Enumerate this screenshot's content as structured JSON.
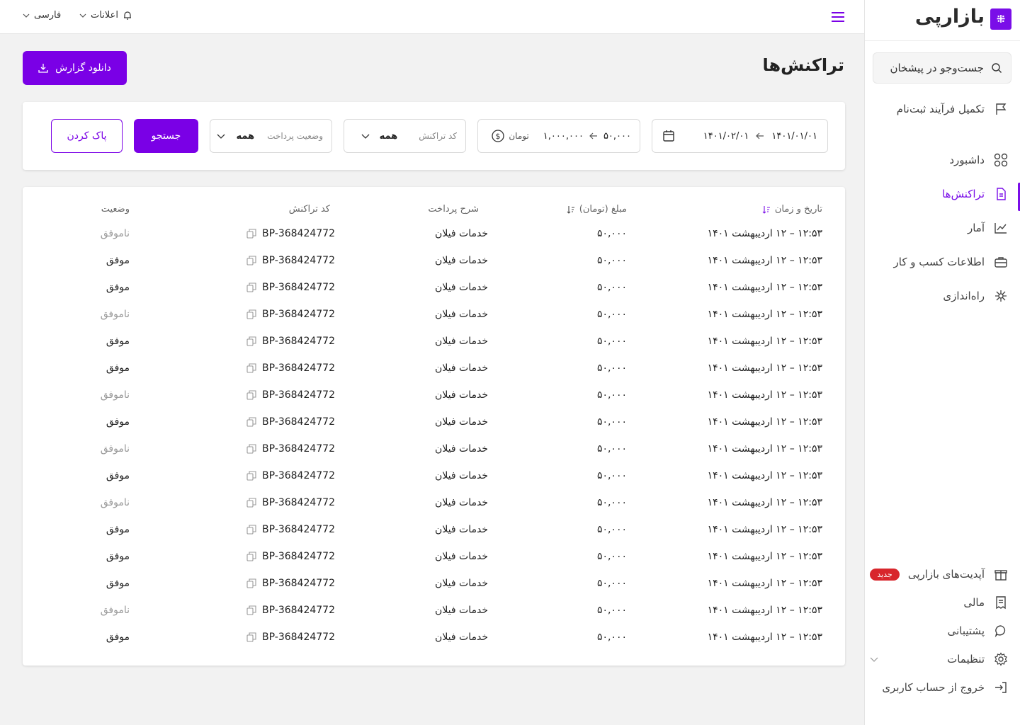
{
  "brand": {
    "name": "بازارپی"
  },
  "topbar": {
    "language": "فارسی",
    "notifications": "اعلانات"
  },
  "sidebar": {
    "search_placeholder": "جست‌وجو در پیشخان",
    "items": [
      {
        "label": "تکمیل فرآیند ثبت‌نام",
        "icon": "flag-icon"
      },
      {
        "label": "داشبورد",
        "icon": "grid-icon"
      },
      {
        "label": "تراکنش‌ها",
        "icon": "document-icon",
        "active": true
      },
      {
        "label": "آمار",
        "icon": "chart-icon"
      },
      {
        "label": "اطلاعات کسب و کار",
        "icon": "briefcase-icon"
      },
      {
        "label": "راه‌اندازی",
        "icon": "spark-icon"
      }
    ],
    "bottom": [
      {
        "label": "آپدیت‌های بازارپی",
        "icon": "gift-icon",
        "badge": "جدید"
      },
      {
        "label": "مالی",
        "icon": "receipt-icon"
      },
      {
        "label": "پشتیبانی",
        "icon": "chat-icon"
      },
      {
        "label": "تنظیمات",
        "icon": "settings-icon"
      },
      {
        "label": "خروج از حساب کاربری",
        "icon": "logout-icon"
      }
    ]
  },
  "page": {
    "title": "تراکنش‌ها",
    "download_label": "دانلود گزارش"
  },
  "filters": {
    "date_from": "۱۴۰۱/۰۱/۰۱",
    "date_to": "۱۴۰۱/۰۲/۰۱",
    "amount_from": "۵۰,۰۰۰",
    "amount_to": "۱,۰۰۰,۰۰۰",
    "amount_unit": "تومان",
    "code_placeholder": "کد تراکنش",
    "code_value": "همه",
    "status_placeholder": "وضعیت پرداخت",
    "status_value": "همه",
    "search_label": "جستجو",
    "clear_label": "پاک کردن"
  },
  "table": {
    "headers": {
      "datetime": "تاریخ و زمان",
      "amount": "مبلغ (تومان)",
      "description": "شرح پرداخت",
      "code": "کد تراکنش",
      "status": "وضعیت"
    },
    "rows": [
      {
        "datetime": "۱۲:۵۳ – ۱۲ اردیبهشت ۱۴۰۱",
        "amount": "۵۰,۰۰۰",
        "description": "خدمات فیلان",
        "code": "BP-368424772",
        "status": "ناموفق",
        "ok": false
      },
      {
        "datetime": "۱۲:۵۳ – ۱۲ اردیبهشت ۱۴۰۱",
        "amount": "۵۰,۰۰۰",
        "description": "خدمات فیلان",
        "code": "BP-368424772",
        "status": "موفق",
        "ok": true
      },
      {
        "datetime": "۱۲:۵۳ – ۱۲ اردیبهشت ۱۴۰۱",
        "amount": "۵۰,۰۰۰",
        "description": "خدمات فیلان",
        "code": "BP-368424772",
        "status": "موفق",
        "ok": true
      },
      {
        "datetime": "۱۲:۵۳ – ۱۲ اردیبهشت ۱۴۰۱",
        "amount": "۵۰,۰۰۰",
        "description": "خدمات فیلان",
        "code": "BP-368424772",
        "status": "ناموفق",
        "ok": false
      },
      {
        "datetime": "۱۲:۵۳ – ۱۲ اردیبهشت ۱۴۰۱",
        "amount": "۵۰,۰۰۰",
        "description": "خدمات فیلان",
        "code": "BP-368424772",
        "status": "موفق",
        "ok": true
      },
      {
        "datetime": "۱۲:۵۳ – ۱۲ اردیبهشت ۱۴۰۱",
        "amount": "۵۰,۰۰۰",
        "description": "خدمات فیلان",
        "code": "BP-368424772",
        "status": "موفق",
        "ok": true
      },
      {
        "datetime": "۱۲:۵۳ – ۱۲ اردیبهشت ۱۴۰۱",
        "amount": "۵۰,۰۰۰",
        "description": "خدمات فیلان",
        "code": "BP-368424772",
        "status": "ناموفق",
        "ok": false
      },
      {
        "datetime": "۱۲:۵۳ – ۱۲ اردیبهشت ۱۴۰۱",
        "amount": "۵۰,۰۰۰",
        "description": "خدمات فیلان",
        "code": "BP-368424772",
        "status": "موفق",
        "ok": true
      },
      {
        "datetime": "۱۲:۵۳ – ۱۲ اردیبهشت ۱۴۰۱",
        "amount": "۵۰,۰۰۰",
        "description": "خدمات فیلان",
        "code": "BP-368424772",
        "status": "ناموفق",
        "ok": false
      },
      {
        "datetime": "۱۲:۵۳ – ۱۲ اردیبهشت ۱۴۰۱",
        "amount": "۵۰,۰۰۰",
        "description": "خدمات فیلان",
        "code": "BP-368424772",
        "status": "موفق",
        "ok": true
      },
      {
        "datetime": "۱۲:۵۳ – ۱۲ اردیبهشت ۱۴۰۱",
        "amount": "۵۰,۰۰۰",
        "description": "خدمات فیلان",
        "code": "BP-368424772",
        "status": "ناموفق",
        "ok": false
      },
      {
        "datetime": "۱۲:۵۳ – ۱۲ اردیبهشت ۱۴۰۱",
        "amount": "۵۰,۰۰۰",
        "description": "خدمات فیلان",
        "code": "BP-368424772",
        "status": "موفق",
        "ok": true
      },
      {
        "datetime": "۱۲:۵۳ – ۱۲ اردیبهشت ۱۴۰۱",
        "amount": "۵۰,۰۰۰",
        "description": "خدمات فیلان",
        "code": "BP-368424772",
        "status": "موفق",
        "ok": true
      },
      {
        "datetime": "۱۲:۵۳ – ۱۲ اردیبهشت ۱۴۰۱",
        "amount": "۵۰,۰۰۰",
        "description": "خدمات فیلان",
        "code": "BP-368424772",
        "status": "موفق",
        "ok": true
      },
      {
        "datetime": "۱۲:۵۳ – ۱۲ اردیبهشت ۱۴۰۱",
        "amount": "۵۰,۰۰۰",
        "description": "خدمات فیلان",
        "code": "BP-368424772",
        "status": "ناموفق",
        "ok": false
      },
      {
        "datetime": "۱۲:۵۳ – ۱۲ اردیبهشت ۱۴۰۱",
        "amount": "۵۰,۰۰۰",
        "description": "خدمات فیلان",
        "code": "BP-368424772",
        "status": "موفق",
        "ok": true
      }
    ]
  },
  "colors": {
    "primary": "#7a00e6",
    "danger": "#d8262c"
  }
}
